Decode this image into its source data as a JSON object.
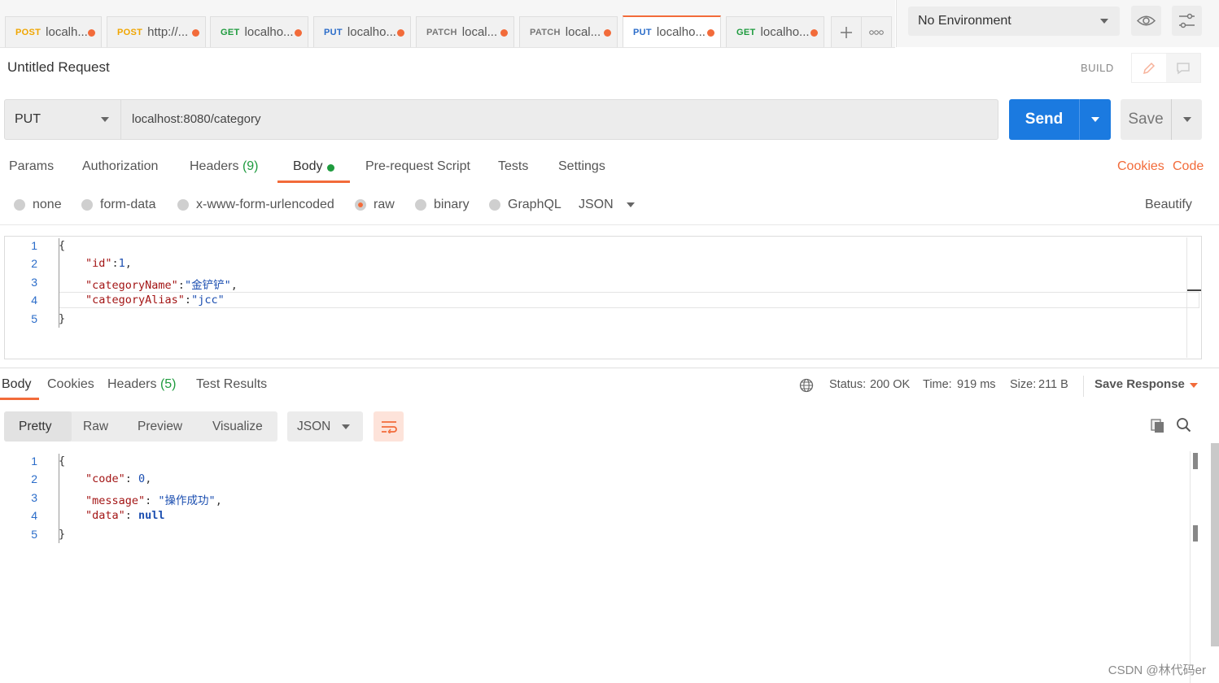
{
  "tabs": [
    {
      "method": "POST",
      "title": "localh..."
    },
    {
      "method": "POST",
      "title": "http://..."
    },
    {
      "method": "GET",
      "title": "localho..."
    },
    {
      "method": "PUT",
      "title": "localho..."
    },
    {
      "method": "PATCH",
      "title": "local..."
    },
    {
      "method": "PATCH",
      "title": "local..."
    },
    {
      "method": "PUT",
      "title": "localho..."
    },
    {
      "method": "GET",
      "title": "localho..."
    }
  ],
  "environment": {
    "selected": "No Environment"
  },
  "request": {
    "name": "Untitled Request",
    "mode": "BUILD",
    "method": "PUT",
    "url": "localhost:8080/category",
    "send_label": "Send",
    "save_label": "Save"
  },
  "request_tabs": {
    "params": "Params",
    "authorization": "Authorization",
    "headers": "Headers",
    "headers_count": "(9)",
    "body": "Body",
    "prerequest": "Pre-request Script",
    "tests": "Tests",
    "settings": "Settings",
    "cookies": "Cookies",
    "code": "Code"
  },
  "body_types": {
    "none": "none",
    "form_data": "form-data",
    "urlencoded": "x-www-form-urlencoded",
    "raw": "raw",
    "binary": "binary",
    "graphql": "GraphQL",
    "format": "JSON",
    "beautify": "Beautify"
  },
  "request_body": {
    "line_numbers": [
      "1",
      "2",
      "3",
      "4",
      "5"
    ],
    "open": "{",
    "l2_key": "\"id\"",
    "l2_val": "1",
    "l3_key": "\"categoryName\"",
    "l3_val": "\"金铲铲\"",
    "l4_key": "\"categoryAlias\"",
    "l4_val": "\"jcc\"",
    "close": "}"
  },
  "response_tabs": {
    "body": "Body",
    "cookies": "Cookies",
    "headers": "Headers",
    "headers_count": "(5)",
    "test_results": "Test Results"
  },
  "response_meta": {
    "status_label": "Status:",
    "status_value": "200 OK",
    "time_label": "Time:",
    "time_value": "919 ms",
    "size_label": "Size:",
    "size_value": "211 B",
    "save_response": "Save Response"
  },
  "response_view": {
    "pretty": "Pretty",
    "raw": "Raw",
    "preview": "Preview",
    "visualize": "Visualize",
    "format": "JSON"
  },
  "response_body": {
    "line_numbers": [
      "1",
      "2",
      "3",
      "4",
      "5"
    ],
    "open": "{",
    "l2_key": "\"code\"",
    "l2_val": "0",
    "l3_key": "\"message\"",
    "l3_val": "\"操作成功\"",
    "l4_key": "\"data\"",
    "l4_val": "null",
    "close": "}"
  },
  "watermark": "CSDN @林代码er",
  "colors": {
    "accent": "#f26b3a",
    "send": "#1b7ae0",
    "success": "#1e9b3e"
  }
}
